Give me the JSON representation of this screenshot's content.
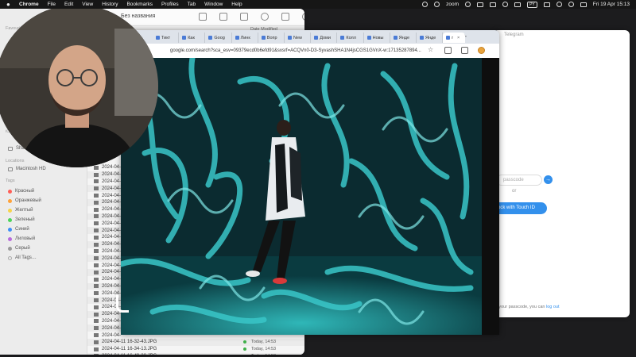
{
  "menubar": {
    "app": "Chrome",
    "menus": [
      "File",
      "Edit",
      "View",
      "History",
      "Bookmarks",
      "Profiles",
      "Tab",
      "Window",
      "Help"
    ],
    "zoom_label": "zoom",
    "keyboard_badge": "PY",
    "clock": "Fri 19 Apr 15:13"
  },
  "finder": {
    "title": "Без названия",
    "column_date_modified": "Date Modified",
    "sidebar": {
      "favourites_label": "Favourites",
      "icloud_label": "iCloud",
      "shared_label": "Shared",
      "locations_label": "Locations",
      "disk_label": "Macintosh HD",
      "tags_label": "Tags",
      "tags": [
        {
          "label": "Красный",
          "color": "#ff5f57"
        },
        {
          "label": "Оранжевый",
          "color": "#ffa23a"
        },
        {
          "label": "Желтый",
          "color": "#f7d34a"
        },
        {
          "label": "Зеленый",
          "color": "#4cd45a"
        },
        {
          "label": "Синий",
          "color": "#3e8ef7"
        },
        {
          "label": "Лиловый",
          "color": "#b86bdc"
        },
        {
          "label": "Серый",
          "color": "#9a9a9a"
        },
        {
          "label": "All Tags…",
          "color": ""
        }
      ]
    },
    "files": [
      {
        "name": "2024-04-",
        "date": ""
      },
      {
        "name": "2024-04-",
        "date": ""
      },
      {
        "name": "2024-04-",
        "date": ""
      },
      {
        "name": "2024-04-",
        "date": ""
      },
      {
        "name": "2024-04-",
        "date": ""
      },
      {
        "name": "2024-04-",
        "date": ""
      },
      {
        "name": "2024-04-",
        "date": ""
      },
      {
        "name": "2024-04-",
        "date": ""
      },
      {
        "name": "2024-04-",
        "date": ""
      },
      {
        "name": "2024-04-",
        "date": ""
      },
      {
        "name": "2024-04-",
        "date": ""
      },
      {
        "name": "2024-04-",
        "date": ""
      },
      {
        "name": "2024-04-",
        "date": ""
      },
      {
        "name": "2024-04-",
        "date": ""
      },
      {
        "name": "2024-04-",
        "date": ""
      },
      {
        "name": "2024-04-",
        "date": ""
      },
      {
        "name": "2024-04-",
        "date": ""
      },
      {
        "name": "2024-04-",
        "date": ""
      },
      {
        "name": "2024-04-",
        "date": ""
      },
      {
        "name": "2024-04-",
        "date": ""
      },
      {
        "name": "2024-04-",
        "date": ""
      },
      {
        "name": "2024-04-",
        "date": ""
      },
      {
        "name": "2024-04-",
        "date": ""
      },
      {
        "name": "2024-04-",
        "date": ""
      },
      {
        "name": "2024-04-",
        "date": ""
      },
      {
        "name": "2024-04-11 16-32-43.JPG",
        "date": "Today, 14:53"
      },
      {
        "name": "2024-04-11 16-34-13.JPG",
        "date": "Today, 14:53"
      },
      {
        "name": "2024-04-11 16-49-20.JPG",
        "date": "Today, 14:53"
      }
    ]
  },
  "chrome": {
    "tabs": [
      {
        "label": "Тикт"
      },
      {
        "label": "Как"
      },
      {
        "label": "Goog"
      },
      {
        "label": "Линк"
      },
      {
        "label": "Вопр"
      },
      {
        "label": "New"
      },
      {
        "label": "Доми"
      },
      {
        "label": "Колл"
      },
      {
        "label": "Новы"
      },
      {
        "label": "Янде"
      },
      {
        "label": "Янде"
      },
      {
        "label": "r"
      }
    ],
    "new_tab_label": "+",
    "url": "google.com/search?sca_esv=09379ecd0b6efd91&sxsrf=ACQVn0-D3-SyvashSHA1N4jsCGS1GVnX-w:1713528789​4..."
  },
  "telegram": {
    "title": "Telegram",
    "passcode_placeholder": "passcode",
    "submit_arrow": "→",
    "or_label": "or",
    "touch_id_label": "ock with Touch ID",
    "forgot_text": "r your passcode, you can",
    "logout_label": "log out"
  },
  "colors": {
    "accent_blue": "#3390ec",
    "tag_green": "#3fb04a"
  }
}
